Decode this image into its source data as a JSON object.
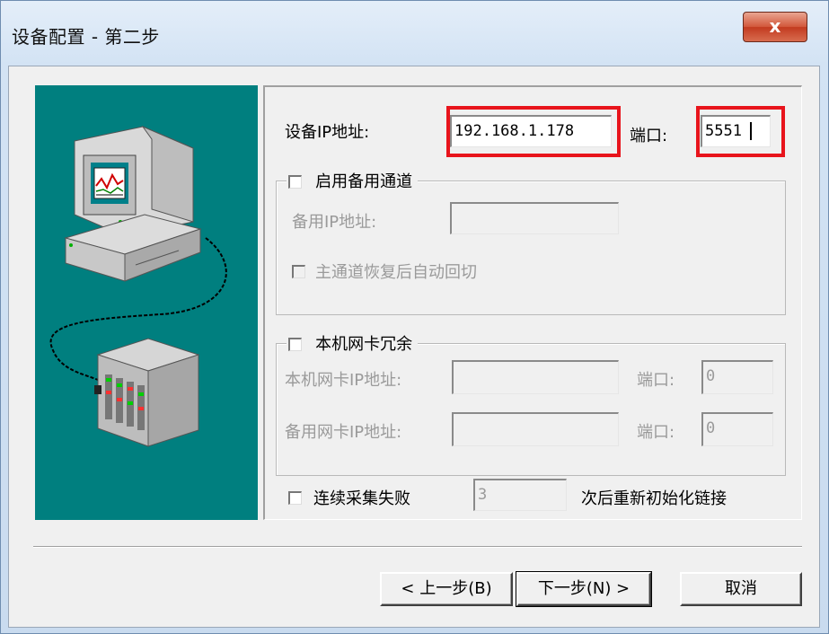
{
  "window": {
    "title": "设备配置 - 第二步",
    "close_glyph": "x"
  },
  "form": {
    "ip_label": "设备IP地址:",
    "ip_value": "192.168.1.178",
    "port_label": "端口:",
    "port_value": "5551",
    "highlight_color": "#e8141c"
  },
  "backup_channel": {
    "checkbox_label": "启用备用通道",
    "checked": false,
    "ip_label": "备用IP地址:",
    "ip_value": "",
    "auto_switch_label": "主通道恢复后自动回切",
    "auto_switch_checked": false
  },
  "nic_redundancy": {
    "checkbox_label": "本机网卡冗余",
    "checked": false,
    "local_ip_label": "本机网卡IP地址:",
    "local_ip_value": "",
    "local_port_label": "端口:",
    "local_port_value": "0",
    "backup_ip_label": "备用网卡IP地址:",
    "backup_ip_value": "",
    "backup_port_label": "端口:",
    "backup_port_value": "0"
  },
  "retry": {
    "checkbox_label": "连续采集失败",
    "checked": false,
    "count_value": "3",
    "suffix_label": "次后重新初始化链接"
  },
  "buttons": {
    "back": "< 上一步(B)",
    "next": "下一步(N) >",
    "cancel": "取消"
  },
  "colors": {
    "art_panel_bg": "#007f7f",
    "dialog_bg": "#f0f0f0"
  }
}
